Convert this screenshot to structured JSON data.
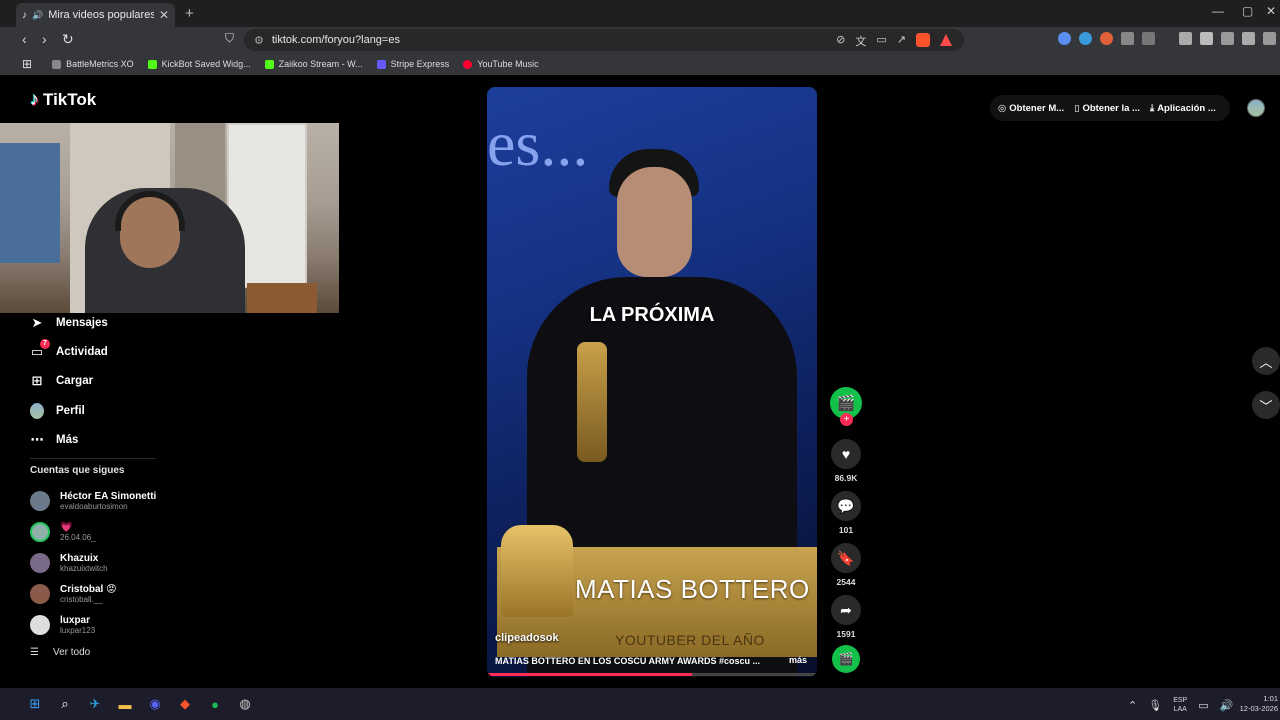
{
  "browser": {
    "tab_title": "Mira videos populares selecci",
    "url": "tiktok.com/foryou?lang=es",
    "bookmarks": [
      {
        "label": "BattleMetrics XO",
        "color": "#888888"
      },
      {
        "label": "KickBot Saved Widg...",
        "color": "#53fc18"
      },
      {
        "label": "Zaiikoo Stream - W...",
        "color": "#53fc18"
      },
      {
        "label": "Stripe Express",
        "color": "#635bff"
      },
      {
        "label": "YouTube Music",
        "color": "#ff0033"
      }
    ]
  },
  "tiktok": {
    "logo_text": "TikTok",
    "menu": [
      {
        "label": "Mensajes",
        "icon": "send-icon"
      },
      {
        "label": "Actividad",
        "icon": "inbox-icon",
        "badge": "7"
      },
      {
        "label": "Cargar",
        "icon": "plus-square-icon"
      },
      {
        "label": "Perfil",
        "icon": "avatar"
      },
      {
        "label": "Más",
        "icon": "more-icon"
      }
    ],
    "following_heading": "Cuentas que sigues",
    "following": [
      {
        "name": "Héctor EA Simonetti",
        "handle": "evaldoaburtosimon",
        "color": "#6b7a8a"
      },
      {
        "name": "💗",
        "handle": "26.04.06_",
        "color": "#8fb0a8"
      },
      {
        "name": "Khazuix",
        "handle": "khazuixtwitch",
        "color": "#7a6a8a"
      },
      {
        "name": "Cristobal 😡",
        "handle": "cristoball.__",
        "color": "#8a5a4a"
      },
      {
        "name": "luxpar",
        "handle": "luxpar123",
        "color": "#dddddd"
      }
    ],
    "see_all": "Ver todo",
    "topbar": {
      "get_coins": "Obtener M...",
      "get_app": "Obtener la ...",
      "download": "Aplicación ..."
    }
  },
  "video": {
    "background_text": "es...",
    "caption": "LA PRÓXIMA",
    "plate_name": "MATIAS BOTTERO",
    "plate_subtitle": "YOUTUBER DEL AÑO",
    "author": "clipeadosok",
    "description": "MATIAS BOTTERO EN LOS COSCU ARMY AWARDS #coscu ...",
    "more_label": "más",
    "progress": 0.62
  },
  "actions": {
    "likes": "86.9K",
    "comments": "101",
    "saves": "2544",
    "shares": "1591"
  },
  "taskbar": {
    "lang_top": "ESP",
    "lang_bottom": "LAA",
    "time": "1:01",
    "date": "12-03-2026"
  }
}
